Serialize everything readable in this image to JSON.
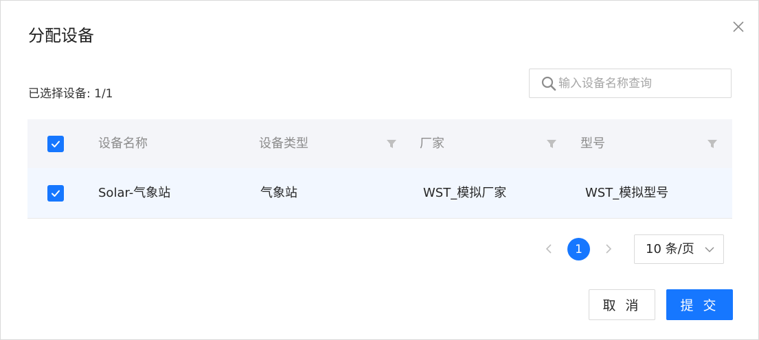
{
  "dialog": {
    "title": "分配设备",
    "selected_count": "已选择设备: 1/1"
  },
  "search": {
    "placeholder": "输入设备名称查询",
    "value": ""
  },
  "table": {
    "columns": [
      "设备名称",
      "设备类型",
      "厂家",
      "型号"
    ],
    "rows": [
      {
        "checked": true,
        "name": "Solar-气象站",
        "type": "气象站",
        "vendor": "WST_模拟厂家",
        "model": "WST_模拟型号"
      }
    ],
    "header_checked": true
  },
  "pagination": {
    "current_page": "1",
    "page_size_label": "10 条/页"
  },
  "buttons": {
    "cancel": "取 消",
    "submit": "提 交"
  },
  "colors": {
    "primary": "#1677ff",
    "header_bg": "#f4f5f9",
    "row_selected_bg": "#f2f7ff"
  }
}
